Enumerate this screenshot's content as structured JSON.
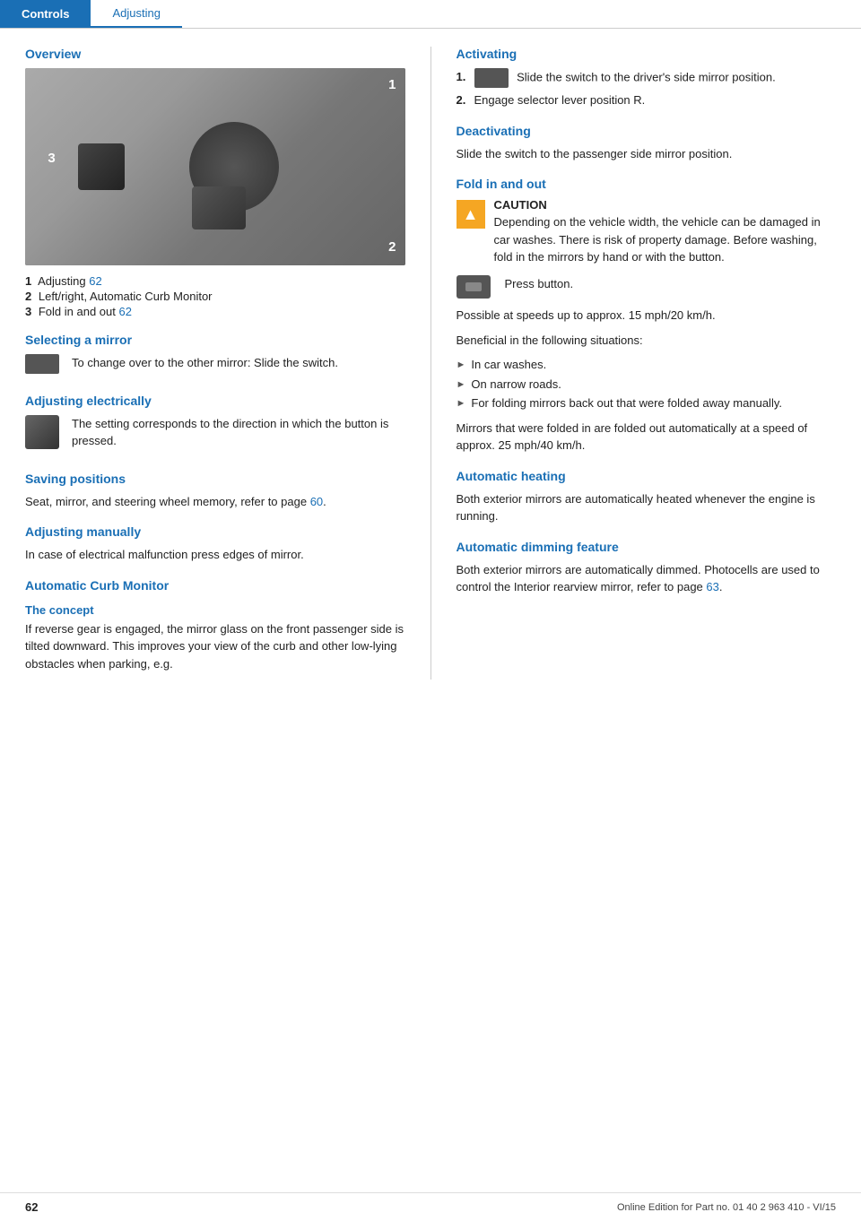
{
  "header": {
    "tab1": "Controls",
    "tab2": "Adjusting"
  },
  "left": {
    "overview_title": "Overview",
    "labels": [
      "1",
      "2",
      "3"
    ],
    "numbered_items": [
      {
        "num": "1",
        "text": "Adjusting",
        "link": "62"
      },
      {
        "num": "2",
        "text": "Left/right, Automatic Curb Monitor"
      },
      {
        "num": "3",
        "text": "Fold in and out",
        "link": "62"
      }
    ],
    "selecting_mirror_title": "Selecting a mirror",
    "selecting_mirror_text": "To change over to the other mirror: Slide the switch.",
    "adjusting_electrically_title": "Adjusting electrically",
    "adjusting_electrically_text": "The setting corresponds to the direction in which the button is pressed.",
    "saving_positions_title": "Saving positions",
    "saving_positions_text": "Seat, mirror, and steering wheel memory, refer to page ",
    "saving_positions_link": "60",
    "saving_positions_text2": ".",
    "adjusting_manually_title": "Adjusting manually",
    "adjusting_manually_text": "In case of electrical malfunction press edges of mirror.",
    "automatic_curb_monitor_title": "Automatic Curb Monitor",
    "the_concept_title": "The concept",
    "the_concept_text": "If reverse gear is engaged, the mirror glass on the front passenger side is tilted downward. This improves your view of the curb and other low-lying obstacles when parking, e.g."
  },
  "right": {
    "activating_title": "Activating",
    "activating_step1": "Slide the switch to the driver's side mirror position.",
    "activating_step2": "Engage selector lever position R.",
    "deactivating_title": "Deactivating",
    "deactivating_text": "Slide the switch to the passenger side mirror position.",
    "fold_in_out_title": "Fold in and out",
    "caution_title": "CAUTION",
    "caution_text": "Depending on the vehicle width, the vehicle can be damaged in car washes. There is risk of property damage. Before washing, fold in the mirrors by hand or with the button.",
    "press_button_text": "Press button.",
    "speeds_text": "Possible at speeds up to approx. 15 mph/20 km/h.",
    "beneficial_text": "Beneficial in the following situations:",
    "bullet_items": [
      "In car washes.",
      "On narrow roads.",
      "For folding mirrors back out that were folded away manually."
    ],
    "mirrors_text": "Mirrors that were folded in are folded out automatically at a speed of approx. 25 mph/40 km/h.",
    "automatic_heating_title": "Automatic heating",
    "automatic_heating_text": "Both exterior mirrors are automatically heated whenever the engine is running.",
    "automatic_dimming_title": "Automatic dimming feature",
    "automatic_dimming_text": "Both exterior mirrors are automatically dimmed. Photocells are used to control the Interior rearview mirror, refer to page ",
    "automatic_dimming_link": "63",
    "automatic_dimming_text2": "."
  },
  "footer": {
    "page_num": "62",
    "footer_text": "Online Edition for Part no. 01 40 2 963 410 - VI/15"
  }
}
